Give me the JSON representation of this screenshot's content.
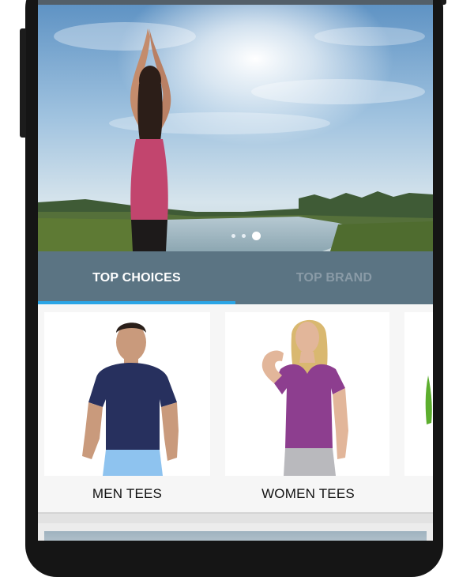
{
  "banner": {
    "slide_count": 3,
    "active_slide": 3
  },
  "tabs": [
    {
      "label": "TOP CHOICES",
      "active": true
    },
    {
      "label": "TOP BRAND",
      "active": false
    }
  ],
  "products": [
    {
      "label": "MEN TEES"
    },
    {
      "label": "WOMEN TEES"
    }
  ],
  "colors": {
    "tab_bar": "#5b7483",
    "tab_indicator": "#2aa5e6",
    "tab_active_text": "#ffffff",
    "tab_inactive_text": "#8a9ba7"
  }
}
